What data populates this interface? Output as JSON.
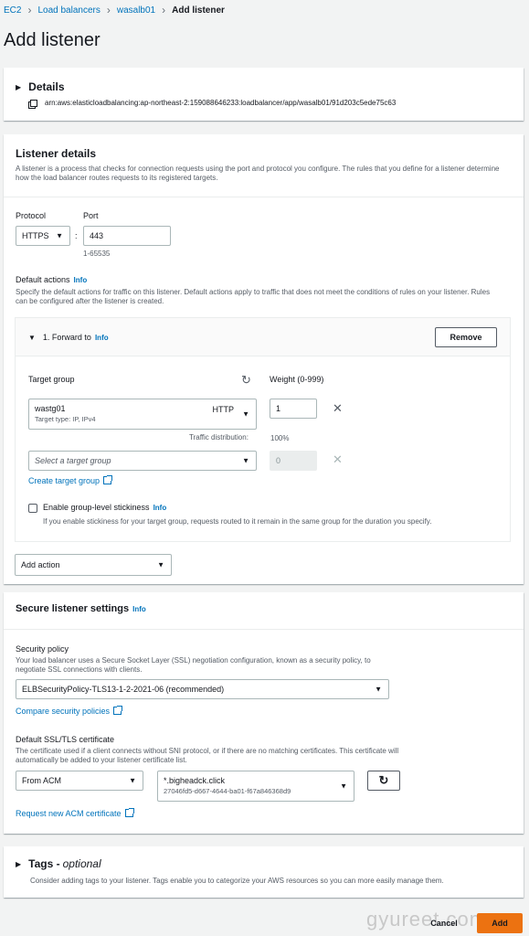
{
  "breadcrumb": {
    "items": [
      "EC2",
      "Load balancers",
      "wasalb01"
    ],
    "current": "Add listener"
  },
  "page_title": "Add listener",
  "details": {
    "title": "Details",
    "arn": "arn:aws:elasticloadbalancing:ap-northeast-2:159088646233:loadbalancer/app/wasalb01/91d203c5ede75c63"
  },
  "listener_details": {
    "title": "Listener details",
    "description": "A listener is a process that checks for connection requests using the port and protocol you configure. The rules that you define for a listener determine how the load balancer routes requests to its registered targets.",
    "protocol_label": "Protocol",
    "protocol_value": "HTTPS",
    "colon": ":",
    "port_label": "Port",
    "port_value": "443",
    "port_hint": "1-65535",
    "default_actions_label": "Default actions",
    "info": "Info",
    "default_actions_desc": "Specify the default actions for traffic on this listener. Default actions apply to traffic that does not meet the conditions of rules on your listener. Rules can be configured after the listener is created.",
    "forward_title": "1. Forward to",
    "remove_label": "Remove",
    "target_group_label": "Target group",
    "weight_label": "Weight (0-999)",
    "tg_name": "wastg01",
    "tg_protocol": "HTTP",
    "tg_meta": "Target type: IP, IPv4",
    "tg_weight": "1",
    "traffic_dist_label": "Traffic distribution:",
    "traffic_dist_value": "100%",
    "select_tg_placeholder": "Select a target group",
    "empty_weight": "0",
    "create_tg_link": "Create target group",
    "stickiness_label": "Enable group-level stickiness",
    "stickiness_desc": "If you enable stickiness for your target group, requests routed to it remain in the same group for the duration you specify.",
    "add_action_label": "Add action"
  },
  "secure": {
    "title": "Secure listener settings",
    "info": "Info",
    "security_policy_label": "Security policy",
    "security_policy_desc": "Your load balancer uses a Secure Socket Layer (SSL) negotiation configuration, known as a security policy, to negotiate SSL connections with clients.",
    "security_policy_value": "ELBSecurityPolicy-TLS13-1-2-2021-06 (recommended)",
    "compare_link": "Compare security policies",
    "cert_label": "Default SSL/TLS certificate",
    "cert_desc": "The certificate used if a client connects without SNI protocol, or if there are no matching certificates. This certificate will automatically be added to your listener certificate list.",
    "cert_source": "From ACM",
    "cert_name": "*.bigheadck.click",
    "cert_id": "27046fd5-d667-4644-ba01-f67a846368d9",
    "request_link": "Request new ACM certificate"
  },
  "tags": {
    "title": "Tags - ",
    "optional": "optional",
    "desc": "Consider adding tags to your listener. Tags enable you to categorize your AWS resources so you can more easily manage them."
  },
  "footer": {
    "cancel": "Cancel",
    "add": "Add",
    "watermark": "gyureet.com"
  },
  "colors": {
    "accent": "#ec7211",
    "link": "#0073bb"
  }
}
